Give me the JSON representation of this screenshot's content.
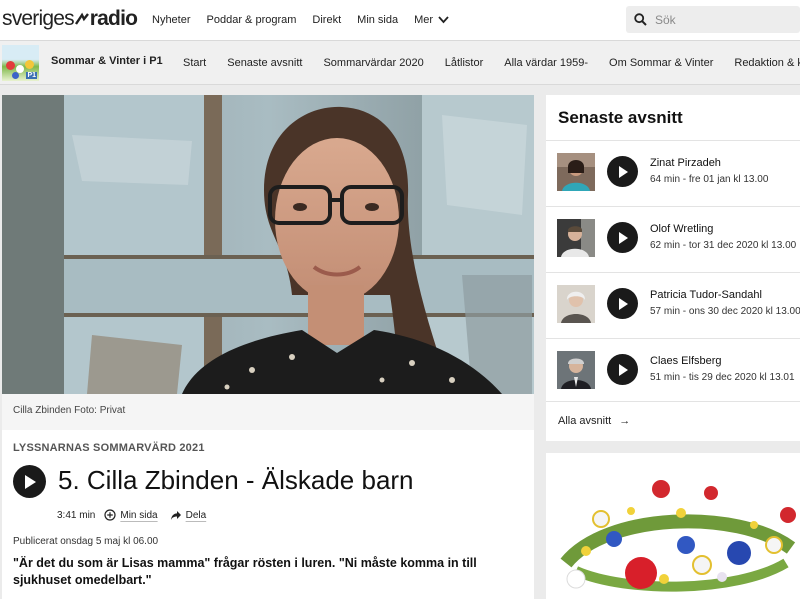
{
  "header": {
    "logo_text_left": "sveriges",
    "logo_text_right": "radio",
    "nav": [
      "Nyheter",
      "Poddar & program",
      "Direkt",
      "Min sida"
    ],
    "more_label": "Mer",
    "search_placeholder": "Sök"
  },
  "program": {
    "title": "Sommar & Vinter i P1",
    "nav": [
      "Start",
      "Senaste avsnitt",
      "Sommarvärdar 2020",
      "Låtlistor",
      "Alla värdar 1959-",
      "Om Sommar & Vinter",
      "Redaktion & kontakt"
    ]
  },
  "article": {
    "photo_caption": "Cilla Zbinden Foto: Privat",
    "kicker": "LYSSNARNAS SOMMARVÄRD 2021",
    "title": "5. Cilla Zbinden - Älskade barn",
    "duration": "3:41 min",
    "my_page_label": "Min sida",
    "share_label": "Dela",
    "published": "Publicerat onsdag 5 maj kl 06.00",
    "lead": "\"Är det du som är Lisas mamma\" frågar rösten i luren. \"Ni måste komma in till sjukhuset omedelbart.\""
  },
  "sidebar": {
    "title": "Senaste avsnitt",
    "episodes": [
      {
        "name": "Zinat Pirzadeh",
        "meta": "64 min  -  fre 01 jan kl 13.00"
      },
      {
        "name": "Olof Wretling",
        "meta": "62 min  -  tor 31 dec 2020 kl 13.00"
      },
      {
        "name": "Patricia Tudor-Sandahl",
        "meta": "57 min  -  ons 30 dec 2020 kl 13.00"
      },
      {
        "name": "Claes Elfsberg",
        "meta": "51 min  -  tis 29 dec 2020 kl 13.01"
      }
    ],
    "all_label": "Alla avsnitt",
    "all_arrow": "→"
  },
  "colors": {
    "accent": "#1a1a1a",
    "background": "#ebebeb",
    "card": "#ffffff"
  }
}
